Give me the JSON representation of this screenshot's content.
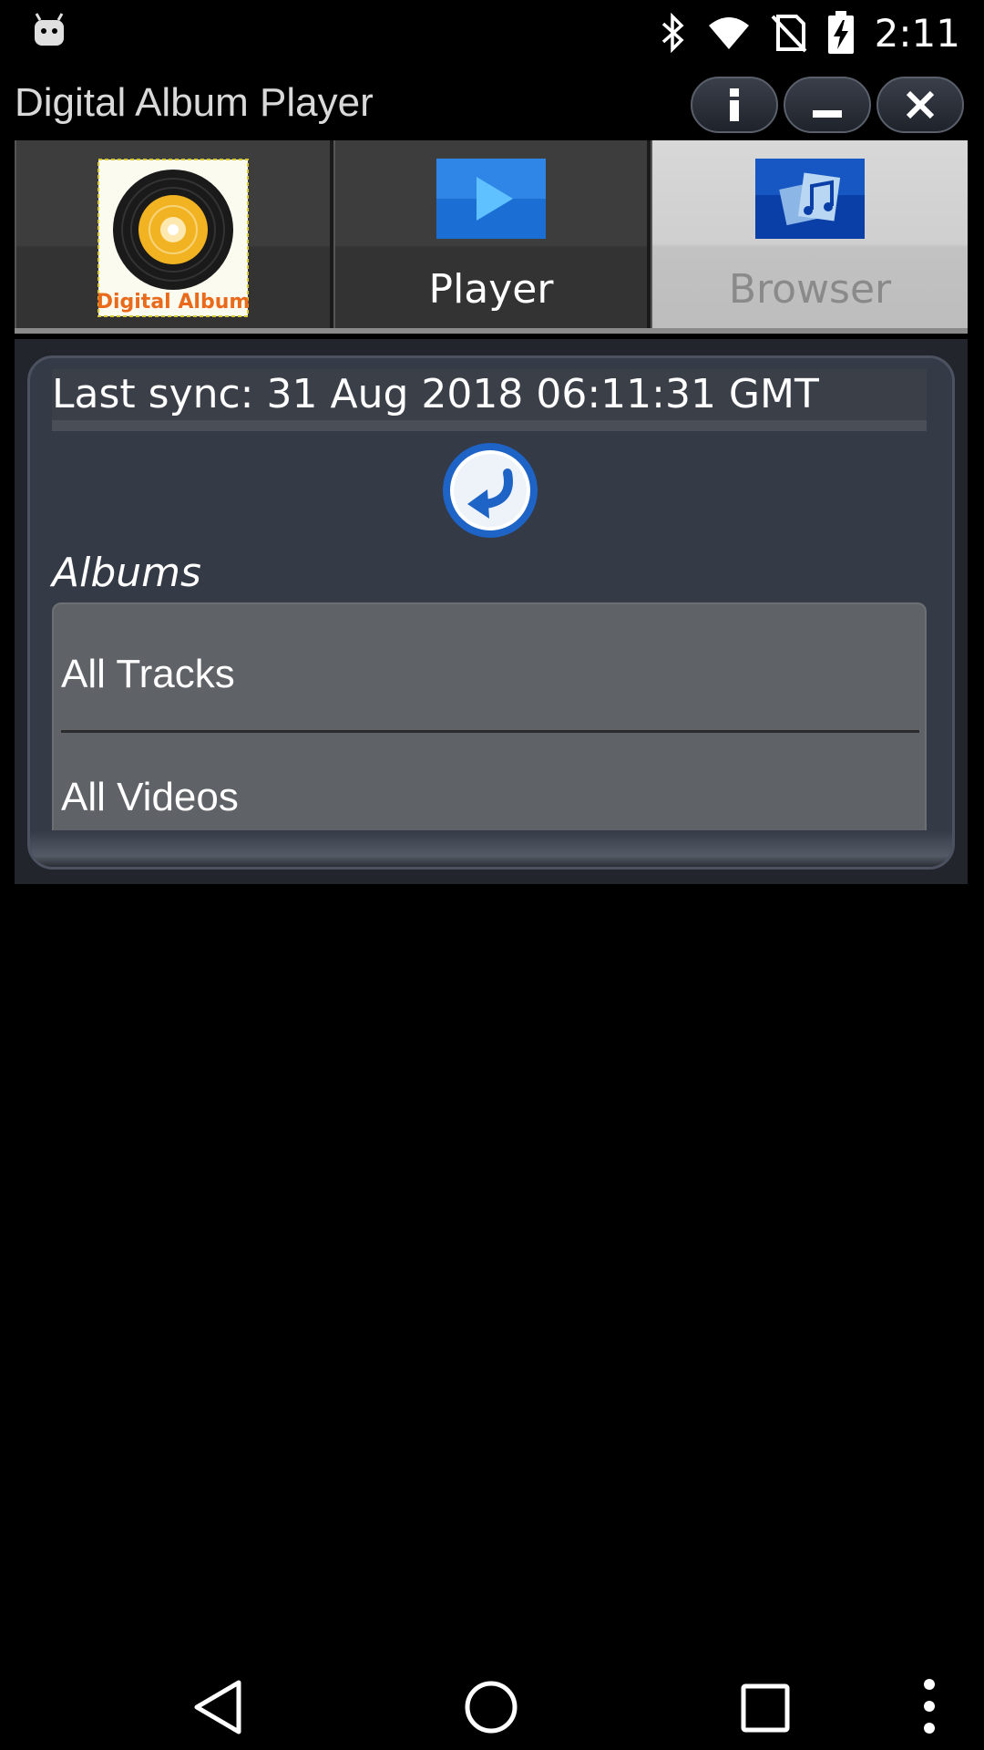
{
  "status_bar": {
    "time": "2:11",
    "icons": [
      "android-debug-icon",
      "bluetooth-icon",
      "wifi-icon",
      "no-sim-icon",
      "battery-charging-icon"
    ]
  },
  "app": {
    "title": "Digital Album Player",
    "window_controls": [
      "info-icon",
      "minimize-icon",
      "close-icon"
    ]
  },
  "tabs": [
    {
      "label": "",
      "icon": "digital-album-logo-icon",
      "logo_text": "Digital Album",
      "selected": false
    },
    {
      "label": "Player",
      "icon": "play-icon",
      "selected": false
    },
    {
      "label": "Browser",
      "icon": "music-library-icon",
      "selected": true
    }
  ],
  "browser": {
    "last_sync": "Last sync: 31 Aug 2018 06:11:31 GMT",
    "refresh_icon": "refresh-back-arrow-icon",
    "section_label": "Albums",
    "items": [
      {
        "label": "All Tracks"
      },
      {
        "label": "All Videos"
      }
    ]
  },
  "nav_bar": {
    "buttons": [
      "back-icon",
      "home-icon",
      "recents-icon",
      "more-options-icon"
    ]
  },
  "colors": {
    "background": "#000000",
    "panel": "#343a46",
    "selected_tab": "#d0d0d0",
    "list_bg": "#5f6266",
    "play_blue": "#1a6fd0"
  }
}
